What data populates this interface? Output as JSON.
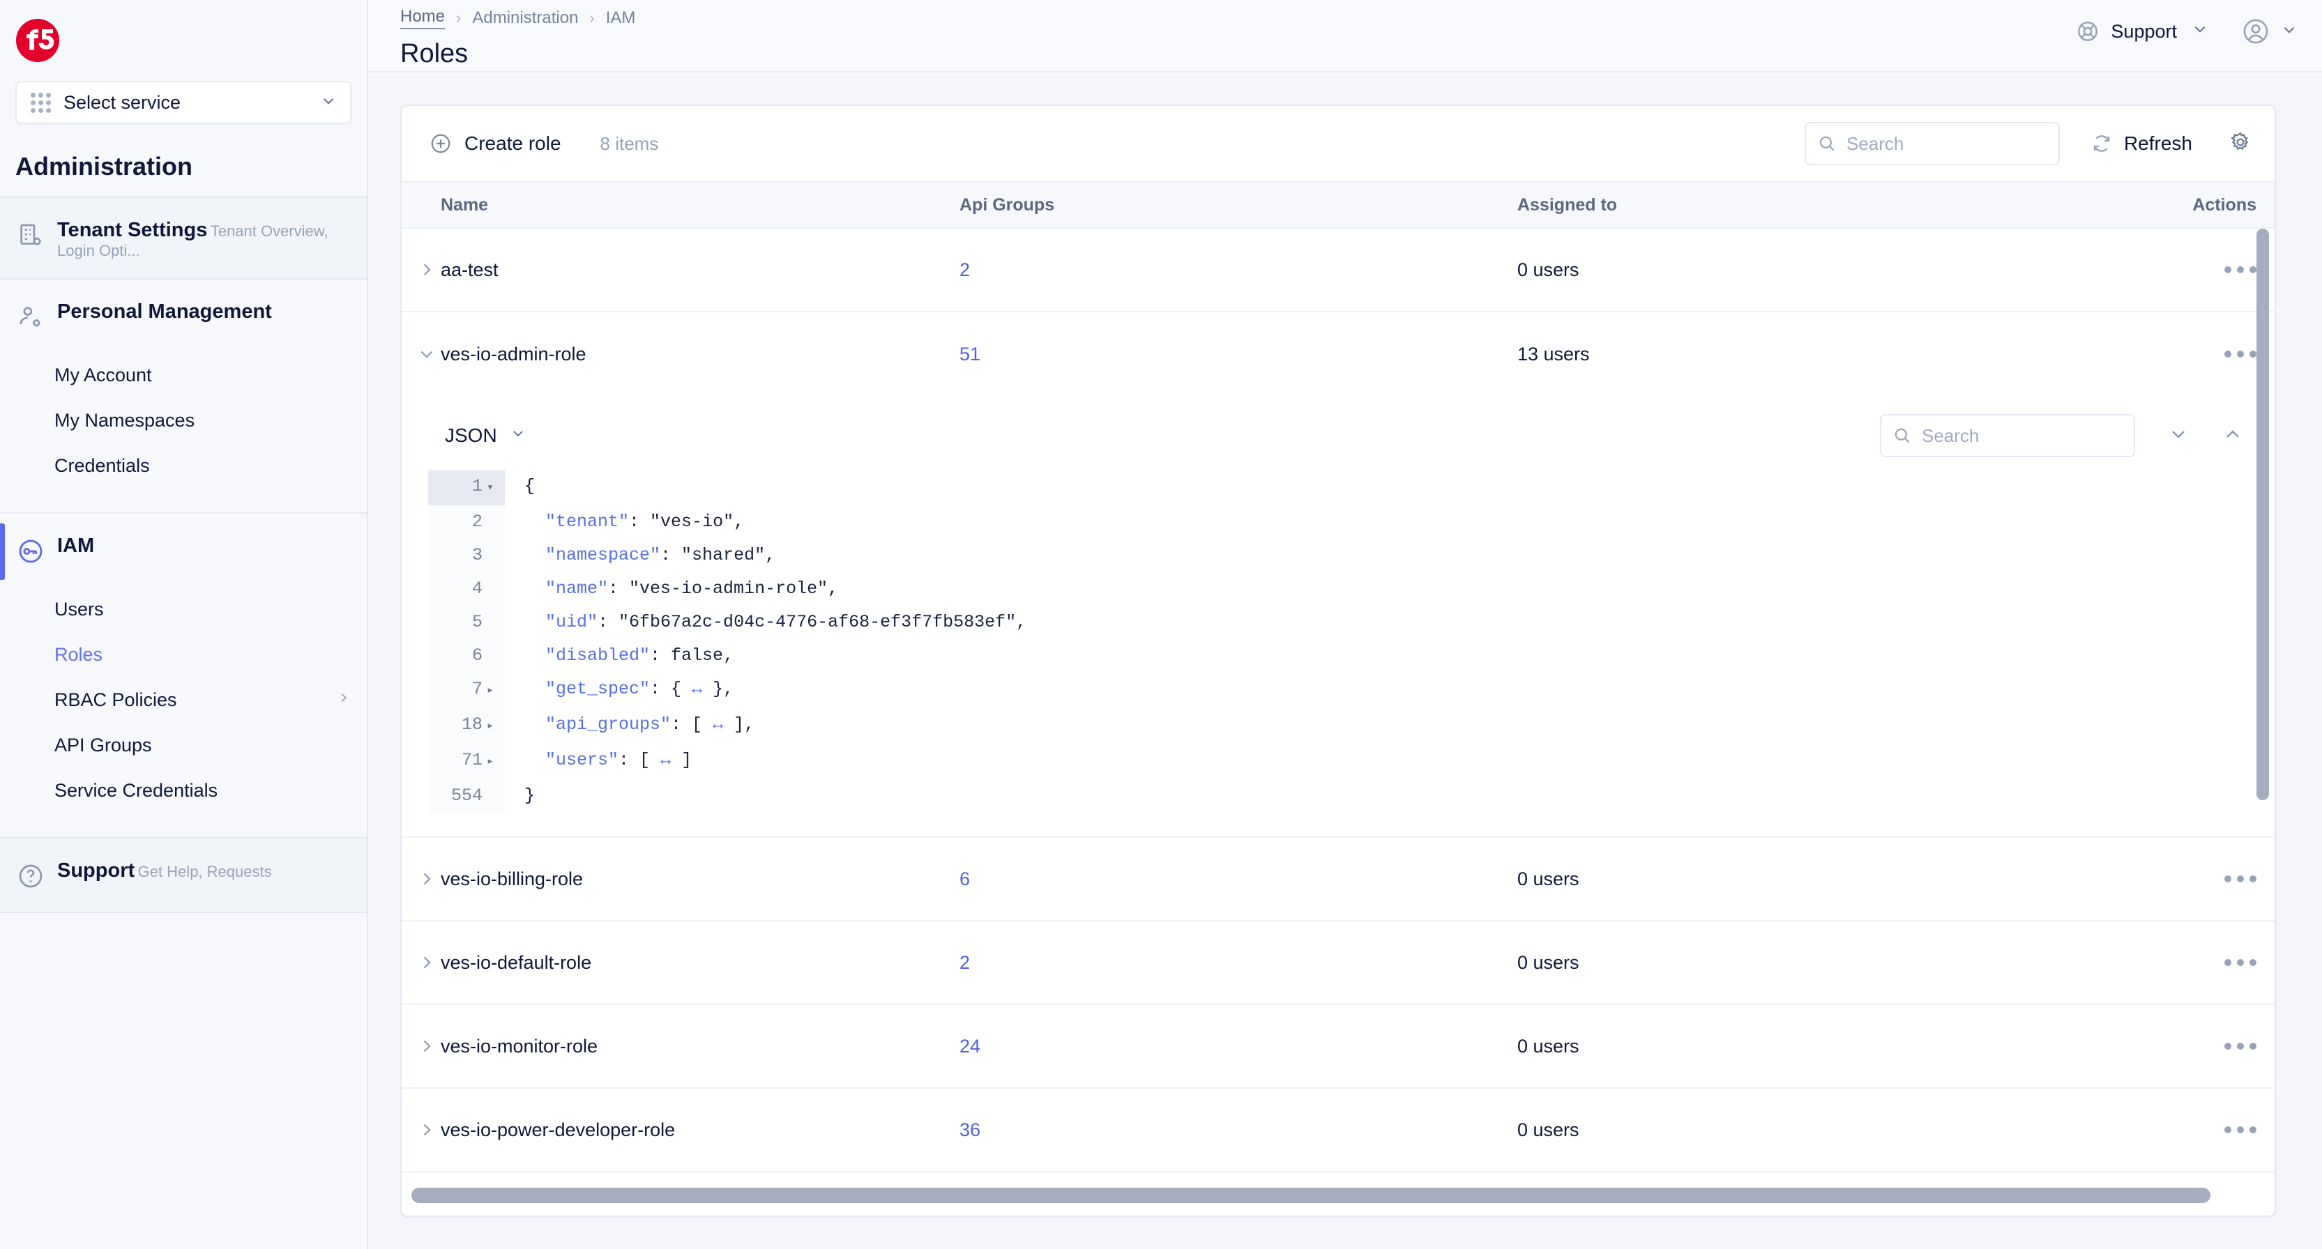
{
  "sidebar": {
    "logo": "f5-logo",
    "service_selector": {
      "label": "Select service",
      "icon": "grid-icon",
      "chevron": "chevron-down-icon"
    },
    "section_title": "Administration",
    "groups": [
      {
        "title": "Tenant Settings",
        "subtitle": "Tenant Overview, Login Opti...",
        "icon": "building-settings-icon",
        "items": []
      },
      {
        "title": "Personal Management",
        "subtitle": "",
        "icon": "user-settings-icon",
        "items": [
          {
            "label": "My Account"
          },
          {
            "label": "My Namespaces"
          },
          {
            "label": "Credentials"
          }
        ]
      },
      {
        "title": "IAM",
        "subtitle": "",
        "icon": "key-icon",
        "items": [
          {
            "label": "Users"
          },
          {
            "label": "Roles"
          },
          {
            "label": "RBAC Policies",
            "arrow": "chevron-right-icon"
          },
          {
            "label": "API Groups"
          },
          {
            "label": "Service Credentials"
          }
        ]
      },
      {
        "title": "Support",
        "subtitle": "Get Help, Requests",
        "icon": "question-circle-icon",
        "items": []
      }
    ]
  },
  "header": {
    "breadcrumbs": [
      "Home",
      "Administration",
      "IAM"
    ],
    "separator": "›",
    "page_title": "Roles",
    "support_label": "Support",
    "support_icon": "lifebuoy-icon",
    "avatar_icon": "user-circle-icon"
  },
  "toolbar": {
    "create_label": "Create role",
    "create_icon": "plus-circle-icon",
    "items_count": "8 items",
    "search_placeholder": "Search",
    "search_icon": "search-icon",
    "refresh_label": "Refresh",
    "refresh_icon": "refresh-icon",
    "settings_icon": "gear-icon"
  },
  "table": {
    "columns": [
      "Name",
      "Api Groups",
      "Assigned to",
      "Actions"
    ],
    "rows": [
      {
        "name": "aa-test",
        "api_groups": "2",
        "assigned_to": "0 users",
        "expanded": false
      },
      {
        "name": "ves-io-admin-role",
        "api_groups": "51",
        "assigned_to": "13 users",
        "expanded": true
      },
      {
        "name": "ves-io-billing-role",
        "api_groups": "6",
        "assigned_to": "0 users",
        "expanded": false
      },
      {
        "name": "ves-io-default-role",
        "api_groups": "2",
        "assigned_to": "0 users",
        "expanded": false
      },
      {
        "name": "ves-io-monitor-role",
        "api_groups": "24",
        "assigned_to": "0 users",
        "expanded": false
      },
      {
        "name": "ves-io-power-developer-role",
        "api_groups": "36",
        "assigned_to": "0 users",
        "expanded": false
      }
    ],
    "actions_icon": "ellipsis-icon",
    "expand_icon": "chevron-right-icon",
    "collapse_icon": "chevron-down-icon"
  },
  "json_panel": {
    "format_label": "JSON",
    "format_chevron": "chevron-down-icon",
    "search_placeholder": "Search",
    "search_icon": "search-icon",
    "next_icon": "chevron-down-icon",
    "prev_icon": "chevron-up-icon",
    "lines": [
      {
        "num": "1",
        "fold": "▾",
        "text": "{"
      },
      {
        "num": "2",
        "fold": "",
        "text": "  \"tenant\": \"ves-io\","
      },
      {
        "num": "3",
        "fold": "",
        "text": "  \"namespace\": \"shared\","
      },
      {
        "num": "4",
        "fold": "",
        "text": "  \"name\": \"ves-io-admin-role\","
      },
      {
        "num": "5",
        "fold": "",
        "text": "  \"uid\": \"6fb67a2c-d04c-4776-af68-ef3f7fb583ef\","
      },
      {
        "num": "6",
        "fold": "",
        "text": "  \"disabled\": false,"
      },
      {
        "num": "7",
        "fold": "▸",
        "text": "  \"get_spec\": { ↔ },"
      },
      {
        "num": "18",
        "fold": "▸",
        "text": "  \"api_groups\": [ ↔ ],"
      },
      {
        "num": "71",
        "fold": "▸",
        "text": "  \"users\": [ ↔ ]"
      },
      {
        "num": "554",
        "fold": "",
        "text": "}"
      }
    ]
  },
  "colors": {
    "brand_red": "#e4002b",
    "accent_blue": "#5b6af0",
    "link_blue": "#4f5fe8",
    "text_dark": "#10173a",
    "text_muted": "#98a1b5"
  }
}
